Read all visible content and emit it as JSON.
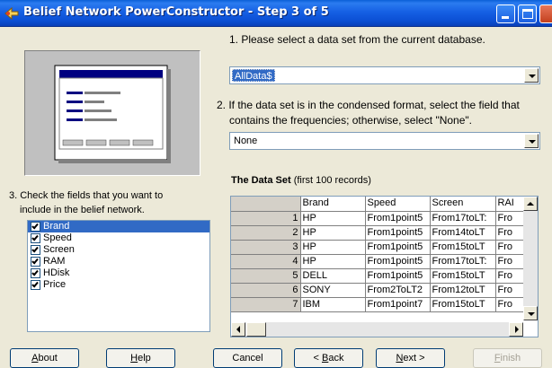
{
  "window": {
    "title": "Belief Network PowerConstructor - Step 3 of 5",
    "controls": [
      "minimize",
      "maximize",
      "close"
    ]
  },
  "step1": {
    "instruction": "1. Please select a data set from the current database.",
    "selected": "AllData$"
  },
  "step2": {
    "instruction_line1": "2. If the data set is in the condensed format, select the field that",
    "instruction_line2": "contains the frequencies; otherwise, select \"None\".",
    "selected": "None"
  },
  "step3": {
    "instruction_line1": "3. Check the fields that you want to",
    "instruction_line2": "include in the belief network.",
    "fields": [
      {
        "label": "Brand",
        "checked": true,
        "selected": true
      },
      {
        "label": "Speed",
        "checked": true,
        "selected": false
      },
      {
        "label": "Screen",
        "checked": true,
        "selected": false
      },
      {
        "label": "RAM",
        "checked": true,
        "selected": false
      },
      {
        "label": "HDisk",
        "checked": true,
        "selected": false
      },
      {
        "label": "Price",
        "checked": true,
        "selected": false
      }
    ]
  },
  "dataset": {
    "heading": "The Data Set",
    "subheading": "(first 100 records)",
    "columns": [
      "Brand",
      "Speed",
      "Screen",
      "RAI"
    ],
    "rows": [
      {
        "n": "1",
        "cells": [
          "HP",
          "From1point5",
          "From17toLT:",
          "Fro"
        ]
      },
      {
        "n": "2",
        "cells": [
          "HP",
          "From1point5",
          "From14toLT",
          "Fro"
        ]
      },
      {
        "n": "3",
        "cells": [
          "HP",
          "From1point5",
          "From15toLT",
          "Fro"
        ]
      },
      {
        "n": "4",
        "cells": [
          "HP",
          "From1point5",
          "From17toLT:",
          "Fro"
        ]
      },
      {
        "n": "5",
        "cells": [
          "DELL",
          "From1point5",
          "From15toLT",
          "Fro"
        ]
      },
      {
        "n": "6",
        "cells": [
          "SONY",
          "From2ToLT2",
          "From12toLT",
          "Fro"
        ]
      },
      {
        "n": "7",
        "cells": [
          "IBM",
          "From1point7",
          "From15toLT",
          "Fro"
        ]
      }
    ]
  },
  "buttons": {
    "about": {
      "before": "",
      "accel": "A",
      "after": "bout"
    },
    "help": {
      "before": "",
      "accel": "H",
      "after": "elp"
    },
    "cancel": {
      "before": "Cancel",
      "accel": "",
      "after": ""
    },
    "back": {
      "before": "< ",
      "accel": "B",
      "after": "ack"
    },
    "next": {
      "before": "",
      "accel": "N",
      "after": "ext >"
    },
    "finish": {
      "before": "",
      "accel": "F",
      "after": "inish"
    }
  },
  "colors": {
    "titlebar": "#0b4fd4",
    "selection": "#316ac5",
    "dialog_bg": "#ece9d8"
  }
}
